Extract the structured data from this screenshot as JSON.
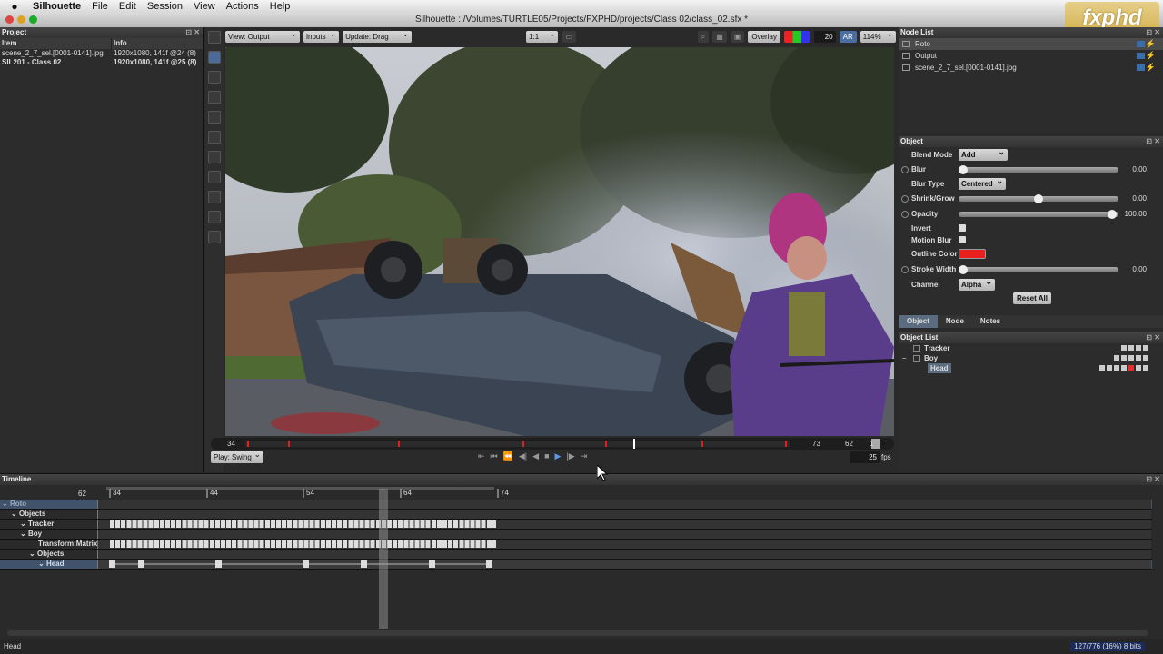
{
  "menubar": {
    "app_name": "Silhouette",
    "items": [
      "File",
      "Edit",
      "Session",
      "View",
      "Actions",
      "Help"
    ]
  },
  "window": {
    "title": "Silhouette : /Volumes/TURTLE05/Projects/FXPHD/projects/Class 02/class_02.sfx *"
  },
  "logo": {
    "text": "fxphd"
  },
  "project": {
    "title": "Project",
    "col_item": "Item",
    "col_info": "Info",
    "rows": [
      {
        "item": "scene_2_7_sel.[0001-0141].jpg",
        "info": "1920x1080, 141f @24 (8)"
      },
      {
        "item": "SIL201 - Class 02",
        "info": "1920x1080, 141f @25 (8)"
      }
    ]
  },
  "viewer_toolbar": {
    "view": "View: Output",
    "inputs": "Inputs",
    "update": "Update: Drag",
    "zoom_ratio": "1:1",
    "overlay": "Overlay",
    "value": "20",
    "ar": "AR",
    "zoom": "114%"
  },
  "scrubber": {
    "start": "34",
    "end": "73",
    "current": "62",
    "step": "1",
    "f_label": "F"
  },
  "transport": {
    "play_mode": "Play: Swing",
    "fps_value": "25",
    "fps_label": "fps"
  },
  "nodelist": {
    "title": "Node List",
    "items": [
      "Roto",
      "Output",
      "scene_2_7_sel.[0001-0141].jpg"
    ]
  },
  "object": {
    "title": "Object",
    "blend_mode_label": "Blend Mode",
    "blend_mode_value": "Add",
    "blur_label": "Blur",
    "blur_value": "0.00",
    "blur_type_label": "Blur Type",
    "blur_type_value": "Centered",
    "shrink_label": "Shrink/Grow",
    "shrink_value": "0.00",
    "opacity_label": "Opacity",
    "opacity_value": "100.00",
    "invert_label": "Invert",
    "motion_blur_label": "Motion Blur",
    "outline_color_label": "Outline Color",
    "outline_color": "#e82020",
    "stroke_width_label": "Stroke Width",
    "stroke_width_value": "0.00",
    "channel_label": "Channel",
    "channel_value": "Alpha",
    "reset_all": "Reset All"
  },
  "tabs": [
    "Object",
    "Node",
    "Notes"
  ],
  "objlist": {
    "title": "Object List",
    "items": [
      "Tracker",
      "Boy",
      "Head"
    ]
  },
  "timeline": {
    "title": "Timeline",
    "current_frame": "62",
    "ticks": [
      "34",
      "44",
      "54",
      "64",
      "74"
    ],
    "rows": [
      "Roto",
      "Objects",
      "Tracker",
      "Boy",
      "Transform:Matrix",
      "Objects",
      "Head"
    ]
  },
  "statusbar": {
    "left": "Head",
    "memory": "127/776 (16%) 8 bits"
  }
}
